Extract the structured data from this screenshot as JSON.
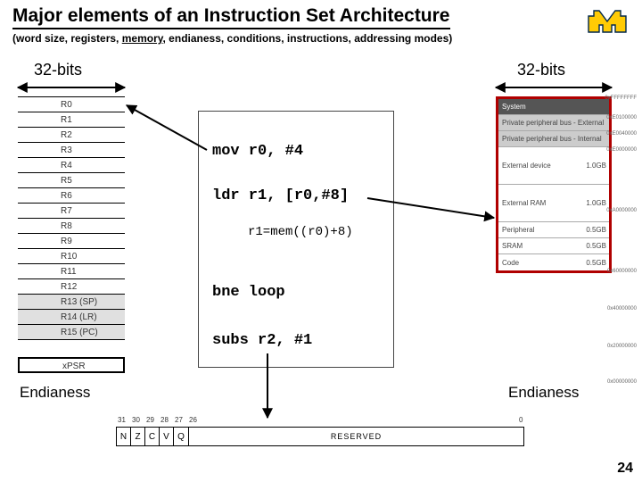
{
  "title": "Major elements of an Instruction Set Architecture",
  "subtitle_pre": "(word size, registers, ",
  "subtitle_mem": "memory",
  "subtitle_post": ", endianess, conditions, instructions, addressing modes)",
  "label_32_left": "32-bits",
  "label_32_right": "32-bits",
  "label_end_left": "Endianess",
  "label_end_right": "Endianess",
  "slide_num": "24",
  "registers": [
    "R0",
    "R1",
    "R2",
    "R3",
    "R4",
    "R5",
    "R6",
    "R7",
    "R8",
    "R9",
    "R10",
    "R11",
    "R12",
    "R13 (SP)",
    "R14 (LR)",
    "R15 (PC)"
  ],
  "reg_xpsr": "xPSR",
  "code": {
    "l1": "mov r0, #4",
    "l2": "ldr r1, [r0,#8]",
    "l3": "r1=mem((r0)+8)",
    "l4": "bne loop",
    "l5": "subs r2, #1"
  },
  "memmap": {
    "rows": [
      {
        "label": "System",
        "cls": "dark",
        "sz": ""
      },
      {
        "label": "Private peripheral bus - External",
        "cls": "med",
        "sz": ""
      },
      {
        "label": "Private peripheral bus - Internal",
        "cls": "med",
        "sz": ""
      },
      {
        "label": "External device",
        "cls": "tall",
        "sz": "1.0GB"
      },
      {
        "label": "External RAM",
        "cls": "tall",
        "sz": "1.0GB"
      },
      {
        "label": "Peripheral",
        "cls": "",
        "sz": "0.5GB"
      },
      {
        "label": "SRAM",
        "cls": "",
        "sz": "0.5GB"
      },
      {
        "label": "Code",
        "cls": "",
        "sz": "0.5GB"
      }
    ],
    "addrs": [
      "0xFFFFFFFF",
      "0xE0100000",
      "0xE0040000",
      "0xE0000000",
      "0xA0000000",
      "0x60000000",
      "0x40000000",
      "0x20000000",
      "0x00000000"
    ]
  },
  "flags": {
    "ticks": [
      "31",
      "30",
      "29",
      "28",
      "27",
      "26",
      "0"
    ],
    "cells": [
      "N",
      "Z",
      "C",
      "V",
      "Q"
    ],
    "reserved": "RESERVED"
  }
}
